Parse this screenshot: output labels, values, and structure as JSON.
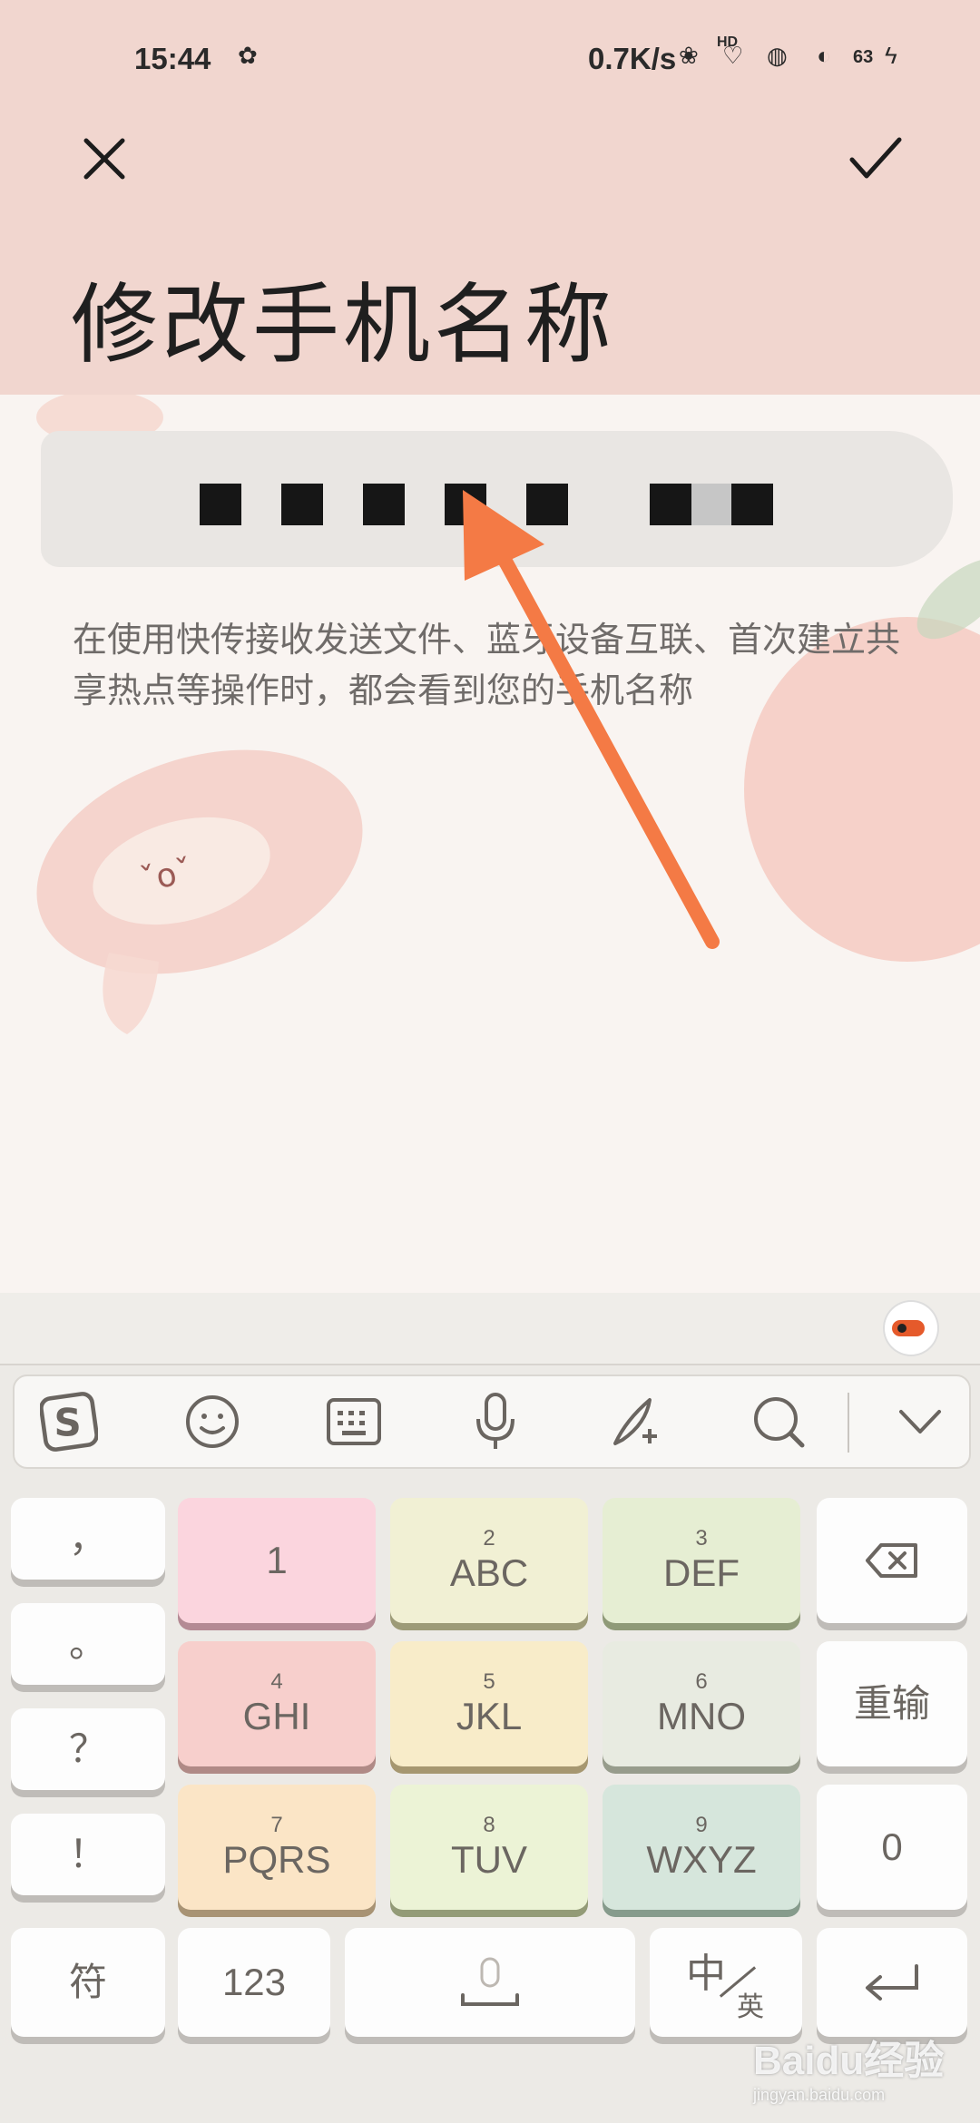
{
  "status_bar": {
    "time": "15:44",
    "net_speed": "0.7K/s",
    "hd_label": "HD",
    "battery": "63"
  },
  "header": {
    "title": "修改手机名称",
    "close_icon": "close-icon",
    "confirm_icon": "check-icon"
  },
  "device_name_field": {
    "value_masked": true
  },
  "description": "在使用快传接收发送文件、蓝牙设备互联、首次建立共享热点等操作时，都会看到您的手机名称",
  "keyboard": {
    "toolbar": [
      "sogou-logo-icon",
      "emoji-icon",
      "keyboard-icon",
      "microphone-icon",
      "handwriting-icon",
      "search-icon",
      "collapse-chevron-icon"
    ],
    "punct_keys": [
      "，",
      "。",
      "？",
      "！"
    ],
    "rows": [
      [
        {
          "num": "",
          "label": "1"
        },
        {
          "num": "2",
          "label": "ABC"
        },
        {
          "num": "3",
          "label": "DEF"
        }
      ],
      [
        {
          "num": "4",
          "label": "GHI"
        },
        {
          "num": "5",
          "label": "JKL"
        },
        {
          "num": "6",
          "label": "MNO"
        }
      ],
      [
        {
          "num": "7",
          "label": "PQRS"
        },
        {
          "num": "8",
          "label": "TUV"
        },
        {
          "num": "9",
          "label": "WXYZ"
        }
      ]
    ],
    "right_keys": {
      "retype": "重输",
      "zero": "0"
    },
    "bottom": {
      "symbols": "符",
      "numbers": "123",
      "lang_main": "中",
      "lang_sub": "英"
    }
  },
  "watermark": {
    "brand": "Baidu经验",
    "sub": "jingyan.baidu.com"
  },
  "colors": {
    "header_bg": "#f1d6cf",
    "arrow": "#f47a45",
    "page_bg": "#f9f4f1"
  }
}
